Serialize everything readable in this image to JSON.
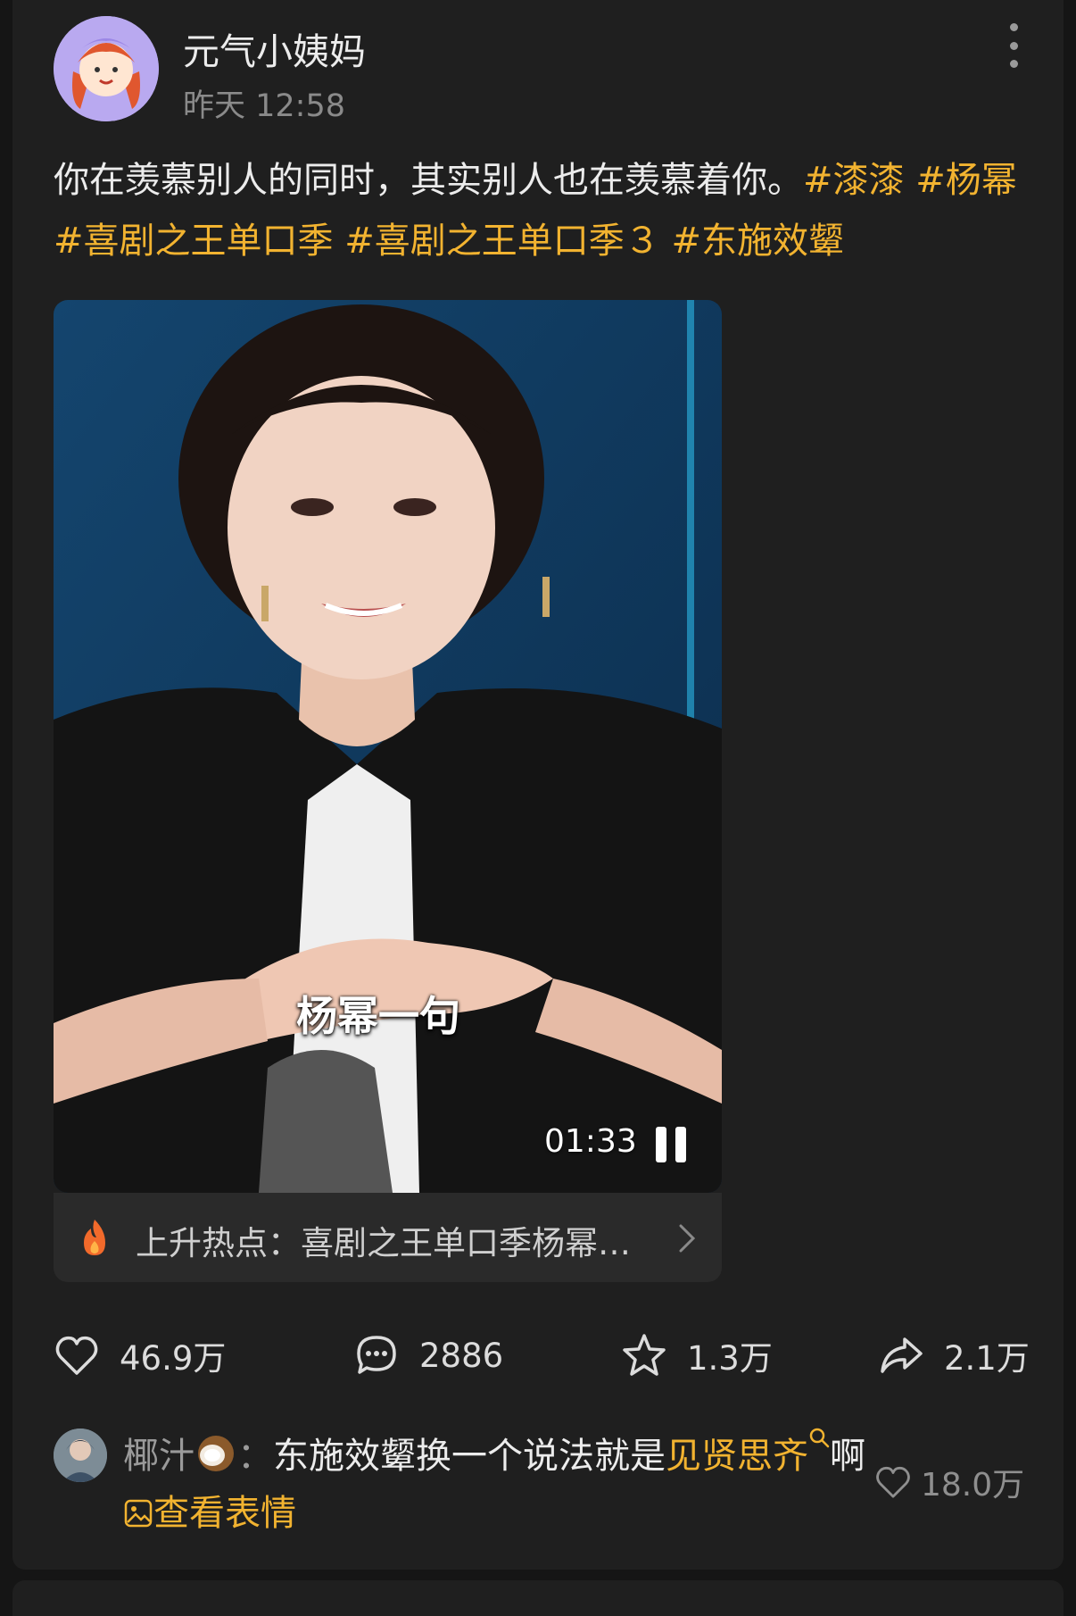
{
  "post": {
    "author": "元气小姨妈",
    "time": "昨天 12:58",
    "text": "你在羡慕别人的同时，其实别人也在羡慕着你。",
    "hashtags": [
      "#漆漆",
      "#杨幂",
      "#喜剧之王单口季",
      "#喜剧之王单口季３",
      "#东施效颦"
    ]
  },
  "video": {
    "subtitle": "杨幂一句",
    "duration": "01:33",
    "hot_topic": "上升热点：喜剧之王单口季杨幂…"
  },
  "actions": {
    "likes": "46.9万",
    "comments": "2886",
    "favorites": "1.3万",
    "shares": "2.1万"
  },
  "top_comment": {
    "user": "椰汁",
    "separator": "：",
    "text_before": "东施效颦换一个说法就是",
    "link_text": "见贤思齐",
    "text_after": "啊",
    "sticker_label": "查看表情",
    "likes": "18.0万"
  },
  "colors": {
    "accent": "#f2b330",
    "background": "#1f1f1f"
  },
  "icons": [
    "more-icon",
    "fire-icon",
    "chevron-right-icon",
    "heart-icon",
    "comment-icon",
    "star-icon",
    "share-icon",
    "coconut-icon",
    "search-icon",
    "sticker-icon",
    "pause-icon"
  ]
}
